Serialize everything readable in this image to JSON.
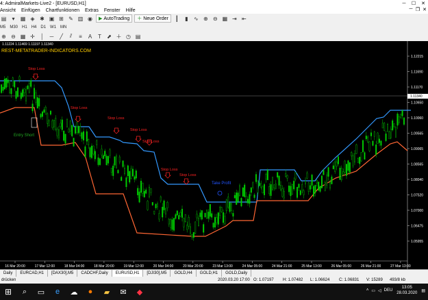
{
  "window": {
    "title": "4: AdmiralMarkets-Live2 - [EURUSD,H1]",
    "min": "─",
    "max": "☐",
    "close": "✕"
  },
  "menu": {
    "items": [
      "Ansicht",
      "Einfügen",
      "Chartfunktionen",
      "Extras",
      "Fenster",
      "Hilfe"
    ],
    "mdi": [
      "─",
      "❐",
      "✕"
    ]
  },
  "toolbar": {
    "autotrading": "AutoTrading",
    "neue_order": "Neue Order",
    "timeframes": [
      "M5",
      "M30",
      "H1",
      "H4",
      "D1",
      "W1",
      "MN"
    ]
  },
  "chart": {
    "ohlc_line": "1.11224 1.11469 1.11197 1.11340",
    "watermark": "REST-METATRADER-INDICATORS.COM",
    "price_labels": [
      "1.12215",
      "1.11690",
      "1.11170",
      "1.10650",
      "1.10060",
      "1.09565",
      "1.09065",
      "1.08565",
      "1.08040",
      "1.07520",
      "1.07000",
      "1.06475",
      "1.05955"
    ],
    "current_price": "1.11340",
    "time_labels": [
      "16 Mar 20:00",
      "17 Mar 12:00",
      "18 Mar 04:00",
      "18 Mar 20:00",
      "19 Mar 12:00",
      "20 Mar 04:00",
      "20 Mar 20:00",
      "23 Mar 13:00",
      "24 Mar 05:00",
      "24 Mar 21:00",
      "25 Mar 13:00",
      "26 Mar 05:00",
      "26 Mar 21:00",
      "27 Mar 13:00"
    ],
    "annotations": {
      "entry_short": "Entry Short",
      "stop_loss": "Stop Loss",
      "take_profit": "Take Profit"
    },
    "colors": {
      "upper_band": "#3399ff",
      "lower_band": "#ff6633",
      "bull": "#00cc00",
      "bear": "#00cc00",
      "sl_text": "#ff2222",
      "entry_text": "#22aa22",
      "tp_text": "#2255ff",
      "watermark": "#ffcc00"
    }
  },
  "tabs": [
    "Daily",
    "EURCAD,H1",
    "[DAX30],M5",
    "CADCHF,Daily",
    "EURUSD,H1",
    "[DJI30],M5",
    "GOLD,H4",
    "GOLD,H1",
    "GOLD,Daily"
  ],
  "active_tab": "EURUSD,H1",
  "status": {
    "left": "drücken",
    "datetime": "2020.03.20 17:00",
    "open": "O: 1.07197",
    "high": "H: 1.07482",
    "low": "L: 1.06624",
    "close": "C: 1.06831",
    "volume": "V: 15289",
    "traffic": "493/8 kb"
  },
  "taskbar": {
    "lang": "DEU",
    "time": "13:05",
    "date": "28.03.2020"
  }
}
